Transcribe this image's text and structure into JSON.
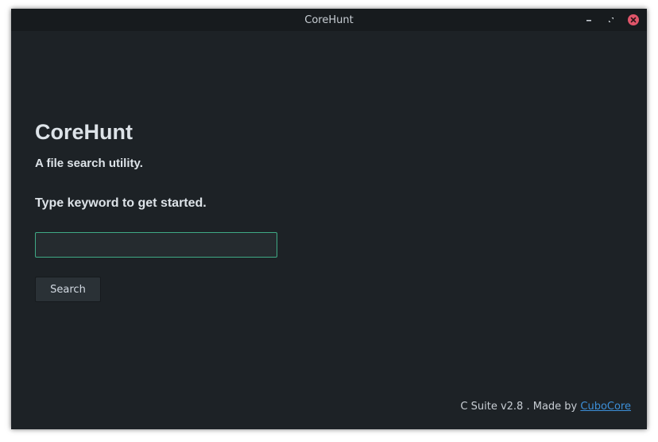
{
  "window": {
    "title": "CoreHunt",
    "controls": [
      {
        "name": "minimize-icon"
      },
      {
        "name": "maximize-icon"
      },
      {
        "name": "close-icon",
        "color": "#e0556a"
      }
    ]
  },
  "main": {
    "app_title": "CoreHunt",
    "subtitle": "A file search utility.",
    "prompt": "Type keyword to get started.",
    "search_input": {
      "value": "",
      "placeholder": ""
    },
    "search_button_label": "Search"
  },
  "footer": {
    "text": "C Suite v2.8 . Made by ",
    "link_label": "CuboCore"
  },
  "colors": {
    "accent": "#3fa985",
    "link": "#3c8fd8",
    "background": "#1d2226",
    "titlebar": "#171b1e"
  }
}
